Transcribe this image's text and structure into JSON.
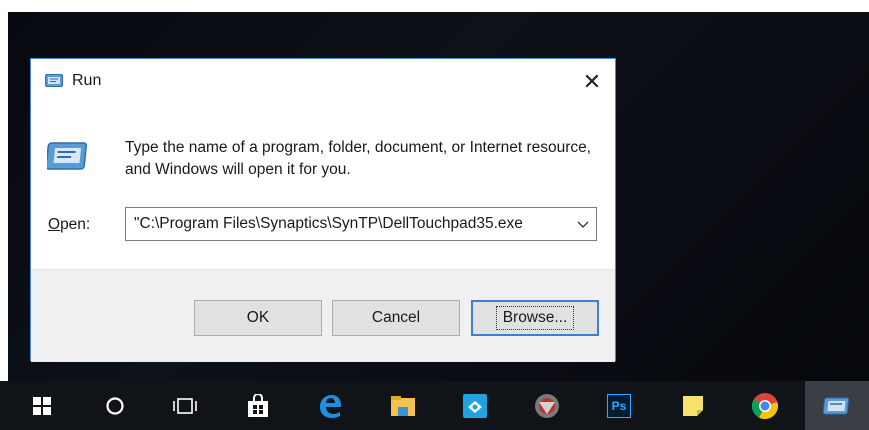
{
  "dialog": {
    "title": "Run",
    "close_glyph": "✕",
    "description": "Type the name of a program, folder, document, or Internet resource, and Windows will open it for you.",
    "open_label": "Open:",
    "open_value": "\"C:\\Program Files\\Synaptics\\SynTP\\DellTouchpad35.exe",
    "buttons": {
      "ok": "OK",
      "cancel": "Cancel",
      "browse": "Browse..."
    },
    "icon": "run-icon"
  },
  "taskbar": {
    "items": [
      {
        "name": "start",
        "icon": "windows-logo-icon"
      },
      {
        "name": "search",
        "icon": "cortana-circle-icon"
      },
      {
        "name": "task-view",
        "icon": "task-view-icon"
      },
      {
        "name": "store",
        "icon": "store-bag-icon"
      },
      {
        "name": "edge",
        "icon": "edge-icon"
      },
      {
        "name": "file-explorer",
        "icon": "folder-icon"
      },
      {
        "name": "app-blue",
        "icon": "blue-app-icon"
      },
      {
        "name": "game",
        "icon": "game-icon"
      },
      {
        "name": "photoshop",
        "icon": "photoshop-icon",
        "label": "Ps"
      },
      {
        "name": "sticky-notes",
        "icon": "sticky-notes-icon"
      },
      {
        "name": "chrome",
        "icon": "chrome-icon"
      },
      {
        "name": "run",
        "icon": "run-icon",
        "active": true
      }
    ]
  },
  "colors": {
    "accent": "#3c7fd1",
    "taskbar": "#101418",
    "desktop": "#0a0d13"
  }
}
